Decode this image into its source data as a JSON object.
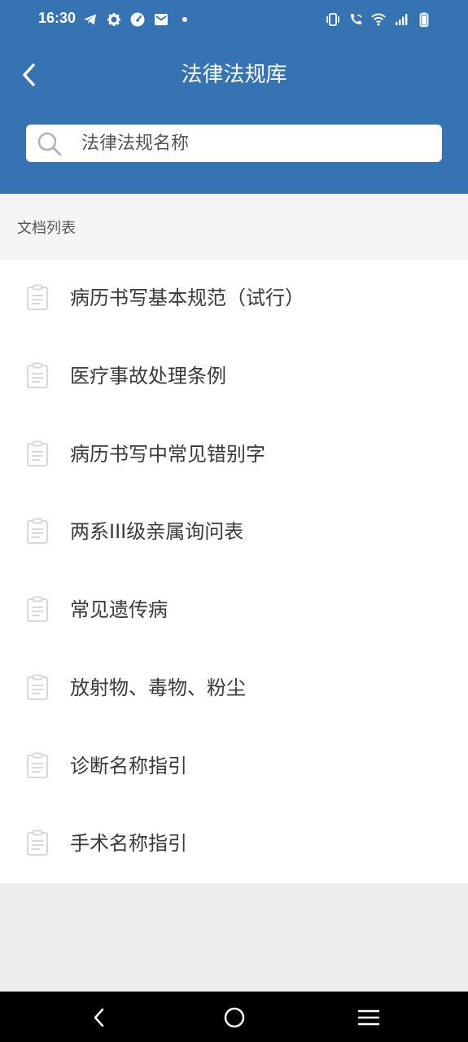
{
  "status_bar": {
    "time": "16:30",
    "left_icons": [
      "telegram-icon",
      "gear-icon",
      "speedometer-icon",
      "mail-icon",
      "dot-icon"
    ],
    "right_icons": [
      "vibrate-icon",
      "wifi-call-icon",
      "wifi-icon",
      "signal-icon",
      "battery-icon"
    ]
  },
  "header": {
    "title": "法律法规库",
    "back_icon": "chevron-left-icon",
    "color": "#3573b3"
  },
  "search": {
    "placeholder": "法律法规名称",
    "value": ""
  },
  "section": {
    "label": "文档列表"
  },
  "documents": [
    {
      "title": "病历书写基本规范（试行）",
      "icon": "document-icon"
    },
    {
      "title": "医疗事故处理条例",
      "icon": "document-icon"
    },
    {
      "title": "病历书写中常见错别字",
      "icon": "document-icon"
    },
    {
      "title": "两系III级亲属询问表",
      "icon": "document-icon"
    },
    {
      "title": "常见遗传病",
      "icon": "document-icon"
    },
    {
      "title": "放射物、毒物、粉尘",
      "icon": "document-icon"
    },
    {
      "title": "诊断名称指引",
      "icon": "document-icon"
    },
    {
      "title": "手术名称指引",
      "icon": "document-icon"
    }
  ],
  "nav_bar": {
    "buttons": [
      "back-icon",
      "home-icon",
      "recents-icon"
    ]
  }
}
